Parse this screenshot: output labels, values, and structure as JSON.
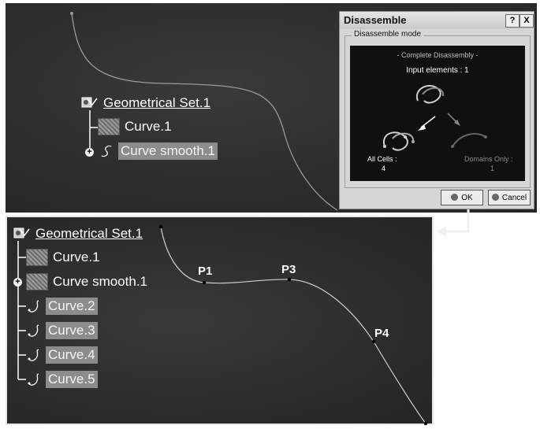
{
  "top_tree": {
    "root_label": "Geometrical Set.1",
    "items": [
      {
        "label": "Curve.1",
        "selected": false
      },
      {
        "label": "Curve smooth.1",
        "selected": true
      }
    ]
  },
  "dialog": {
    "title": "Disassemble",
    "help_button": "?",
    "close_button": "X",
    "fieldset_label": "Disassemble mode",
    "preview": {
      "mode_title": "- Complete Disassembly -",
      "input_elements": "Input elements : 1",
      "all_cells_label": "All Cells :",
      "all_cells_value": "4",
      "domains_only_label": "Domains Only :",
      "domains_only_value": "1"
    },
    "ok_label": "OK",
    "cancel_label": "Cancel"
  },
  "bottom_tree": {
    "root_label": "Geometrical Set.1",
    "items": [
      {
        "label": "Curve.1",
        "selected": false
      },
      {
        "label": "Curve smooth.1",
        "selected": false
      },
      {
        "label": "Curve.2",
        "selected": true
      },
      {
        "label": "Curve.3",
        "selected": true
      },
      {
        "label": "Curve.4",
        "selected": true
      },
      {
        "label": "Curve.5",
        "selected": true
      }
    ]
  },
  "points": {
    "p1": "P1",
    "p3": "P3",
    "p4": "P4"
  },
  "icons": {
    "set": "geometrical-set-icon",
    "curve": "curve-thumbnail-icon",
    "smooth": "curve-smooth-icon",
    "expand": "expand-plus-icon"
  }
}
